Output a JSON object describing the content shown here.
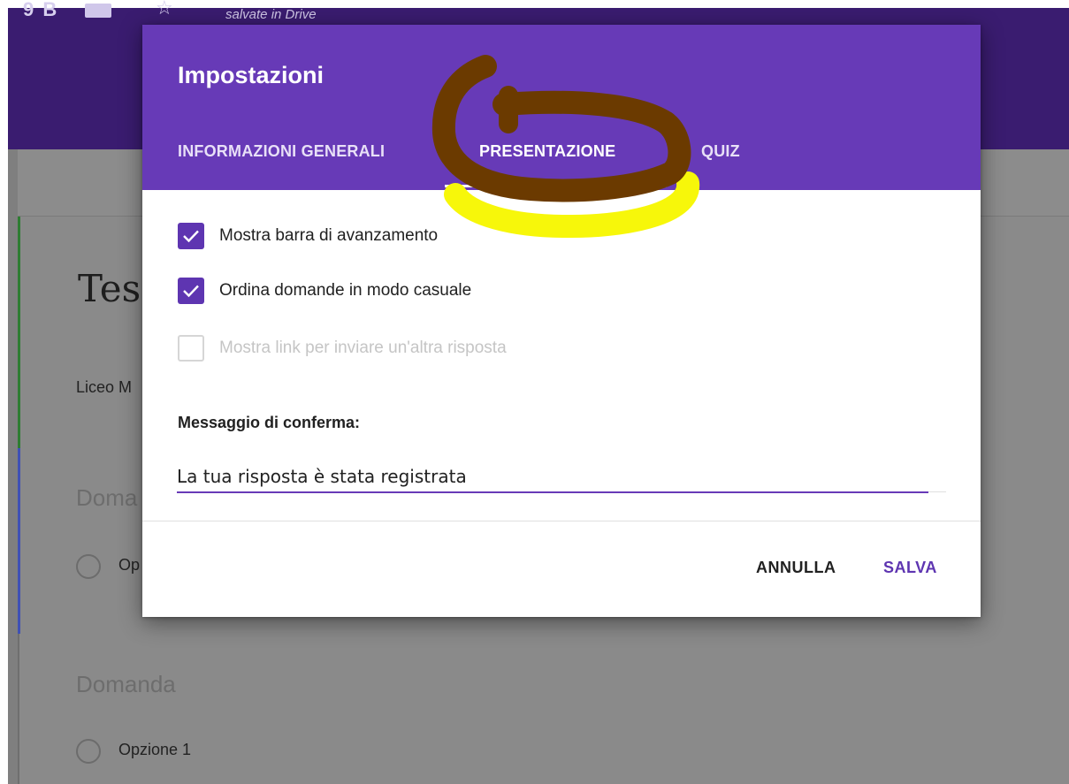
{
  "background": {
    "top_number": "9 B",
    "saved_status": "salvate in Drive",
    "form_title_partial": "Tes",
    "form_description_partial": "Liceo M",
    "question1_partial": "Doma",
    "option1_partial": "Op",
    "question2": "Domanda",
    "option2": "Opzione 1"
  },
  "dialog": {
    "title": "Impostazioni",
    "tabs": [
      {
        "label": "INFORMAZIONI GENERALI"
      },
      {
        "label": "PRESENTAZIONE",
        "selected": true
      },
      {
        "label": "QUIZ"
      }
    ],
    "options": [
      {
        "label": "Mostra barra di avanzamento",
        "checked": true,
        "enabled": true
      },
      {
        "label": "Ordina domande in modo casuale",
        "checked": true,
        "enabled": true
      },
      {
        "label": "Mostra link per inviare un'altra risposta",
        "checked": false,
        "enabled": false
      }
    ],
    "confirm_label": "Messaggio di conferma:",
    "confirm_value": "La tua risposta è stata registrata",
    "cancel_label": "ANNULLA",
    "save_label": "SALVA"
  },
  "colors": {
    "accent": "#673ab7",
    "header_dark": "#3a1c70",
    "annotation_brown": "#6b3a00",
    "annotation_yellow": "#f7f70a"
  }
}
